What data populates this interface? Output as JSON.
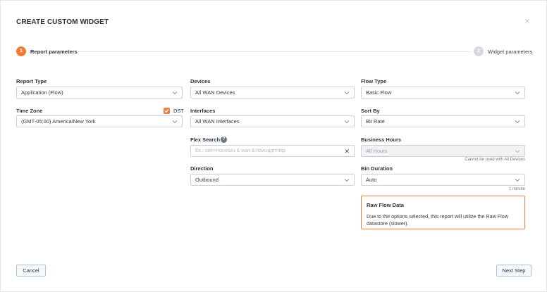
{
  "dialog": {
    "title": "CREATE CUSTOM WIDGET",
    "close_glyph": "×"
  },
  "steps": [
    {
      "number": "1",
      "label": "Report parameters",
      "active": true
    },
    {
      "number": "2",
      "label": "Widget parameters",
      "active": false
    }
  ],
  "fields": {
    "report_type": {
      "label": "Report Type",
      "value": "Application (Flow)"
    },
    "time_zone": {
      "label": "Time Zone",
      "value": "(GMT-05:00) America/New York",
      "dst_label": "DST",
      "dst_checked": true
    },
    "devices": {
      "label": "Devices",
      "value": "All WAN Devices"
    },
    "interfaces": {
      "label": "Interfaces",
      "value": "All WAN Interfaces"
    },
    "flex_search": {
      "label": "Flex Search",
      "placeholder": "Ex.: site=Honolulu & wan & flow.app=http",
      "value": "",
      "help_glyph": "?"
    },
    "direction": {
      "label": "Direction",
      "value": "Outbound"
    },
    "flow_type": {
      "label": "Flow Type",
      "value": "Basic Flow"
    },
    "sort_by": {
      "label": "Sort By",
      "value": "Bit Rate"
    },
    "business_hours": {
      "label": "Business Hours",
      "value": "All Hours",
      "hint": "Cannot be used with All Devices",
      "disabled": true
    },
    "bin_duration": {
      "label": "Bin Duration",
      "value": "Auto",
      "hint": "1 minute"
    }
  },
  "notice": {
    "title": "Raw Flow Data",
    "text": "Due to the options selected, this report will utilize the Raw Flow datastore (slower)."
  },
  "footer": {
    "cancel_label": "Cancel",
    "next_label": "Next Step"
  },
  "colors": {
    "accent": "#f07c3a",
    "step_inactive": "#d5d9de",
    "border": "#cdd2d8",
    "button_border": "#a9c3de"
  }
}
